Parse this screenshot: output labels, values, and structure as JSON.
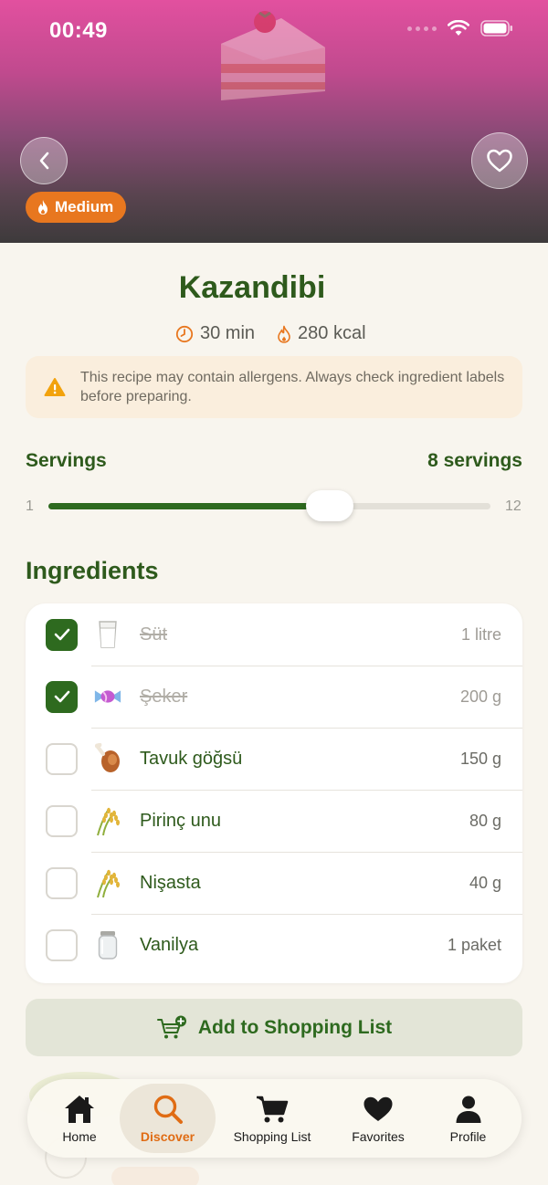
{
  "status_bar": {
    "time": "00:49"
  },
  "hero": {
    "difficulty": "Medium"
  },
  "recipe": {
    "title": "Kazandibi",
    "time": "30 min",
    "calories": "280 kcal",
    "allergen_warning": "This recipe may contain allergens. Always check ingredient labels before preparing."
  },
  "servings": {
    "label": "Servings",
    "value_text": "8 servings",
    "min": "1",
    "max": "12",
    "value": 8
  },
  "ingredients": {
    "heading": "Ingredients",
    "items": [
      {
        "name": "Süt",
        "qty": "1 litre",
        "checked": true,
        "icon": "milk-glass-icon"
      },
      {
        "name": "Şeker",
        "qty": "200 g",
        "checked": true,
        "icon": "candy-icon"
      },
      {
        "name": "Tavuk göğsü",
        "qty": "150 g",
        "checked": false,
        "icon": "poultry-leg-icon"
      },
      {
        "name": "Pirinç unu",
        "qty": "80 g",
        "checked": false,
        "icon": "rice-plant-icon"
      },
      {
        "name": "Nişasta",
        "qty": "40 g",
        "checked": false,
        "icon": "rice-plant-icon"
      },
      {
        "name": "Vanilya",
        "qty": "1 paket",
        "checked": false,
        "icon": "jar-icon"
      }
    ]
  },
  "shopping_button": "Add to Shopping List",
  "tabs": [
    {
      "label": "Home",
      "icon": "home-icon",
      "active": false
    },
    {
      "label": "Discover",
      "icon": "search-icon",
      "active": true
    },
    {
      "label": "Shopping List",
      "icon": "cart-icon",
      "active": false
    },
    {
      "label": "Favorites",
      "icon": "heart-icon",
      "active": false
    },
    {
      "label": "Profile",
      "icon": "person-icon",
      "active": false
    }
  ],
  "colors": {
    "accent_green": "#2e6a1f",
    "accent_orange": "#e8771f",
    "background": "#f8f5ee"
  }
}
